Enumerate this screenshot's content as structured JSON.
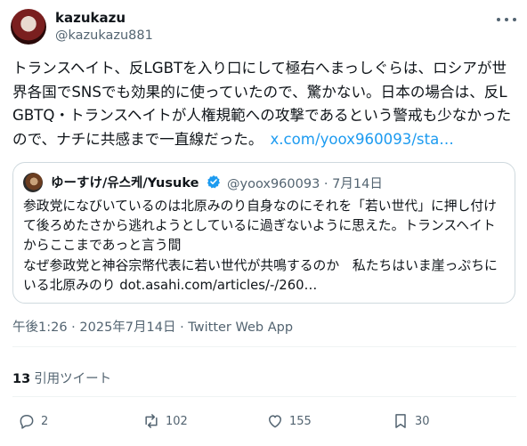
{
  "author": {
    "name": "kazukazu",
    "handle": "@kazukazu881"
  },
  "tweet": {
    "text": "トランスヘイト、反LGBTを入り口にして極右へまっしぐらは、ロシアが世界各国でSNSでも効果的に使っていたので、驚かない。日本の場合は、反LGBTQ・トランスヘイトが人権規範への攻撃であるという警戒も少なかったので、ナチに共感まで一直線だった。",
    "link": "x.com/yoox960093/sta…"
  },
  "quoted": {
    "name": "ゆーすけ/유스케/Yusuke",
    "meta": "@yoox960093 · 7月14日",
    "lines": [
      "参政党になびいているのは北原みのり自身なのにそれを「若い世代」に押し付け",
      "て後ろめたさから逃れようとしているに過ぎないように思えた。トランスヘイト",
      "からここまであっと言う間",
      "なぜ参政党と神谷宗幣代表に若い世代が共鳴するのか　私たちはいま崖っぷちに",
      "いる北原みのり dot.asahi.com/articles/-/260…"
    ]
  },
  "timestamp": "午後1:26 · 2025年7月14日 · Twitter Web App",
  "quote_stats": {
    "count": "13",
    "label": "引用ツイート"
  },
  "actions": {
    "replies": "2",
    "retweets": "102",
    "likes": "155",
    "bookmarks": "30"
  },
  "colors": {
    "link": "#1d9bf0",
    "secondary": "#536471",
    "verified": "#1d9bf0"
  }
}
